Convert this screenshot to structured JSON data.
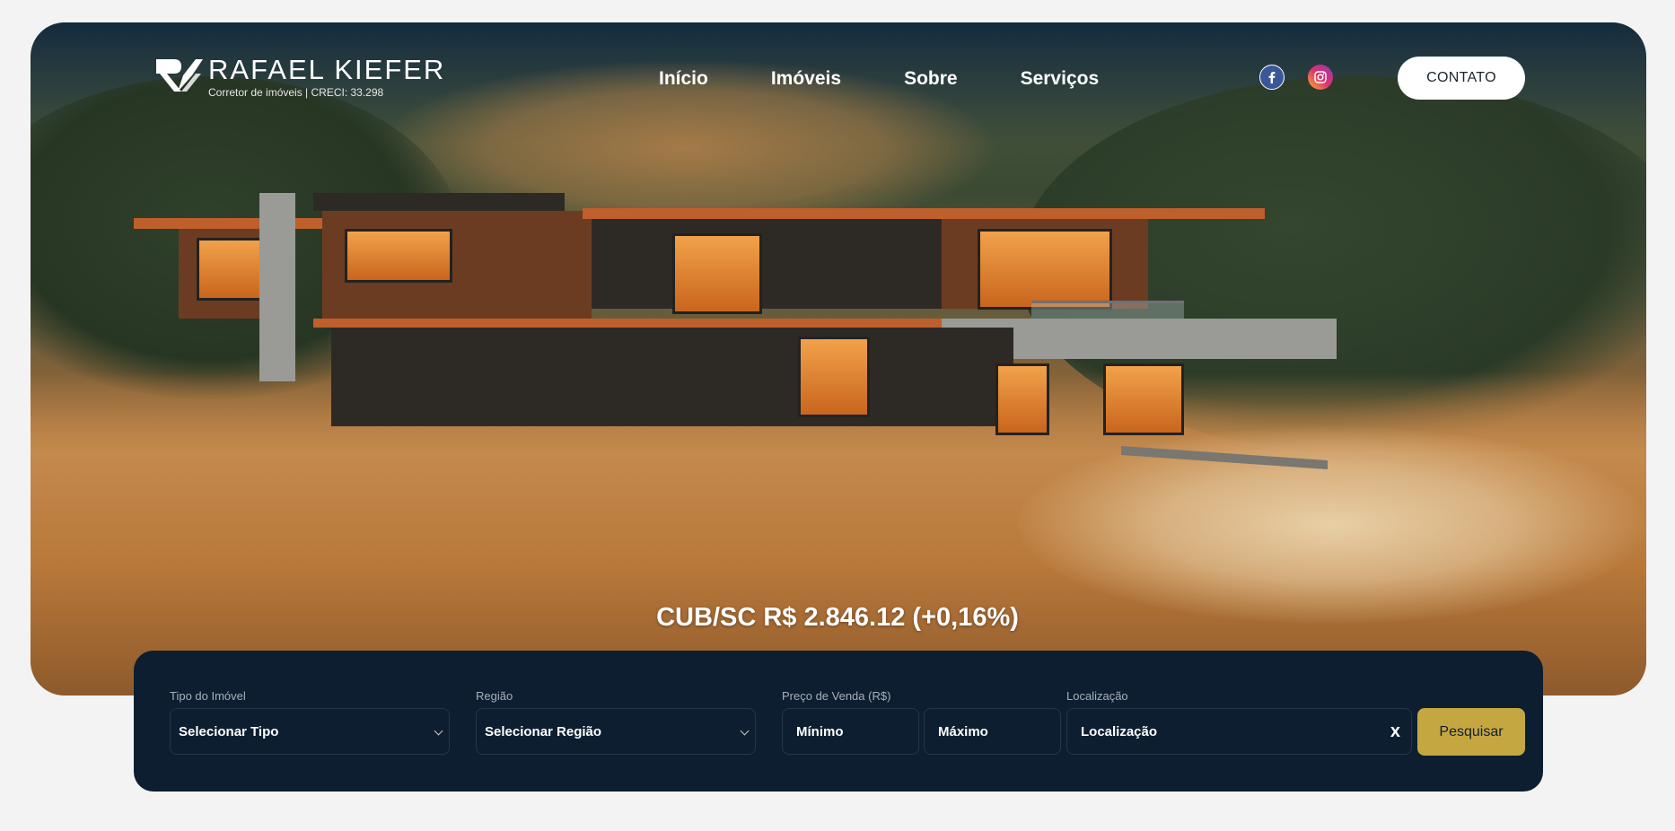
{
  "brand": {
    "name": "RAFAEL KIEFER",
    "tagline": "Corretor de imóveis | CRECI: 33.298"
  },
  "nav": {
    "items": [
      "Início",
      "Imóveis",
      "Sobre",
      "Serviços"
    ]
  },
  "social": {
    "facebook_icon": "facebook-icon",
    "instagram_icon": "instagram-icon"
  },
  "contact_label": "CONTATO",
  "cub_text": "CUB/SC R$ 2.846.12 (+0,16%)",
  "search": {
    "type": {
      "label": "Tipo do Imóvel",
      "value": "Selecionar Tipo"
    },
    "region": {
      "label": "Região",
      "value": "Selecionar Região"
    },
    "price": {
      "label": "Preço de Venda (R$)",
      "min": "Mínimo",
      "max": "Máximo"
    },
    "location": {
      "label": "Localização",
      "value": "Localização",
      "clear": "x"
    },
    "button": "Pesquisar"
  },
  "colors": {
    "panel": "#0c1e30",
    "accent": "#c5a742",
    "page_bg": "#f3f3f3"
  }
}
